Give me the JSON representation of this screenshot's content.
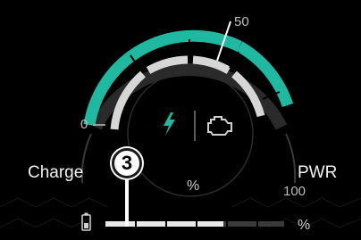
{
  "gauge": {
    "labels": {
      "left": "Charge",
      "right": "PWR"
    },
    "ticks": {
      "min": "0",
      "mid": "50",
      "max": "100"
    },
    "center_unit": "%",
    "charge_bar_unit": "%",
    "callout_number": "3",
    "icons": {
      "charge": "lightning-bolt-icon",
      "power": "engine-icon",
      "battery": "battery-icon"
    },
    "colors": {
      "accent": "#1fb8a0",
      "arc_light": "#d9d9d9",
      "background": "#000000"
    }
  }
}
